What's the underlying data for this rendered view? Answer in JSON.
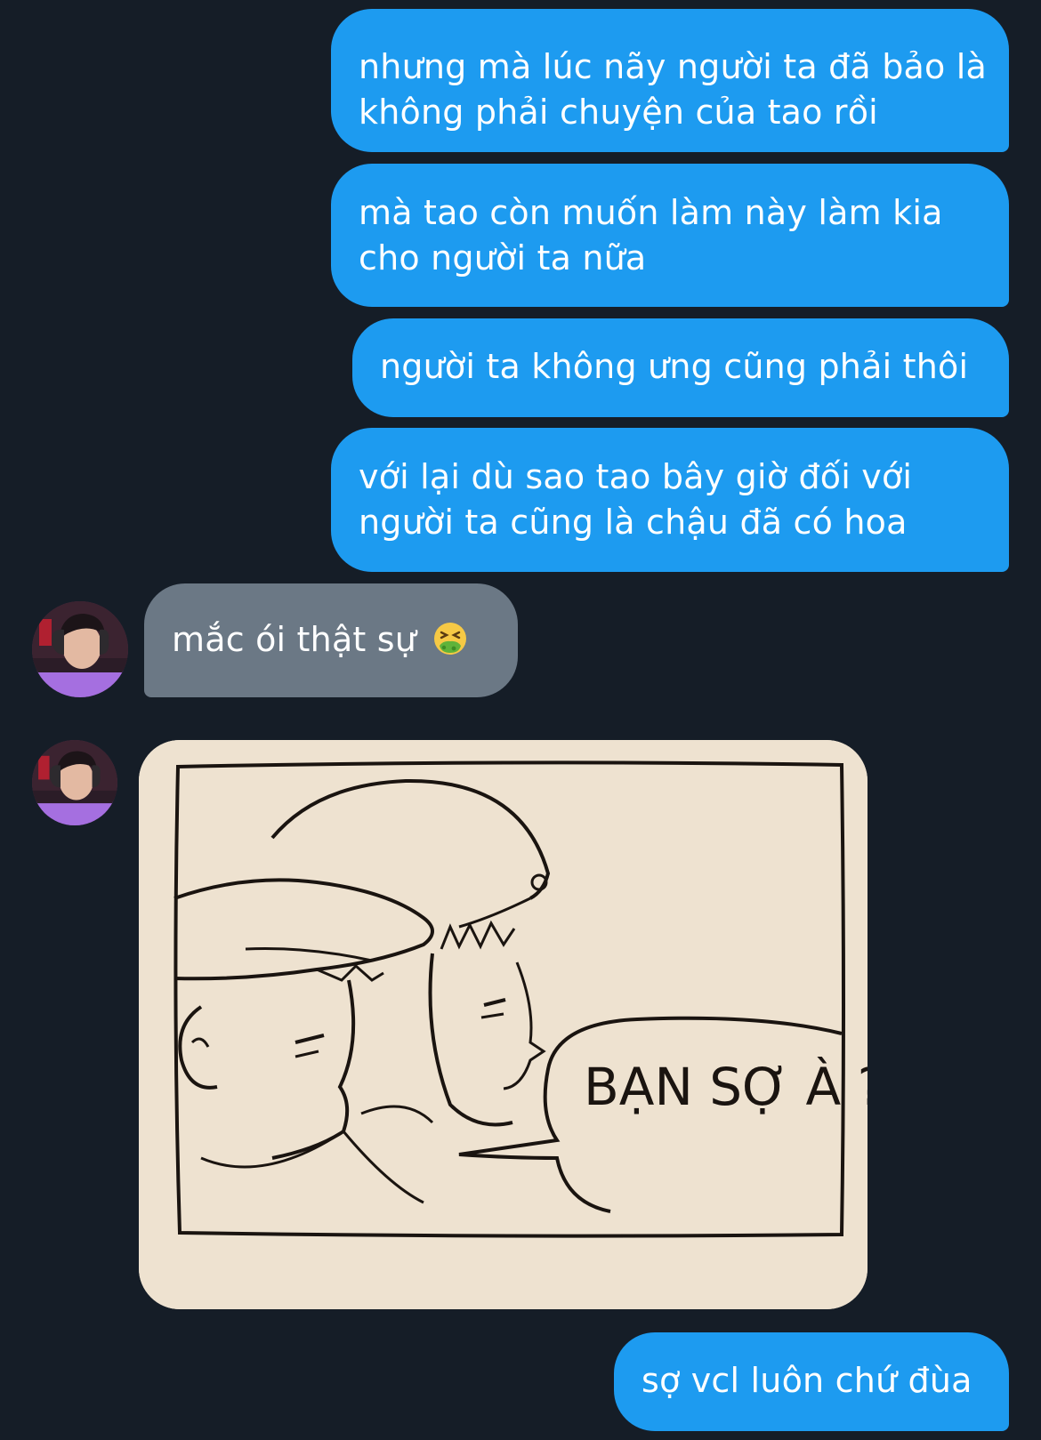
{
  "conversation": {
    "messages": [
      {
        "direction": "outgoing",
        "text": "nhưng mà lúc nãy người ta đã bảo là không phải chuyện của tao rồi"
      },
      {
        "direction": "outgoing",
        "text": "mà tao còn muốn làm này làm kia cho người ta nữa"
      },
      {
        "direction": "outgoing",
        "text": "người ta không ưng cũng phải thôi"
      },
      {
        "direction": "outgoing",
        "text": "với lại dù sao tao bây giờ đối với người ta cũng là chậu đã có hoa"
      },
      {
        "direction": "incoming",
        "text": "mắc ói thật sự",
        "emoji": "nauseated-face-icon"
      },
      {
        "direction": "incoming",
        "type": "image",
        "comic_text": "BẠN SỢ À ?"
      },
      {
        "direction": "outgoing",
        "text": "sợ vcl luôn chứ đùa"
      }
    ]
  },
  "colors": {
    "background": "#151d27",
    "outgoing_bubble": "#1d9bf0",
    "incoming_bubble": "#6b7885",
    "text": "#ffffff"
  }
}
